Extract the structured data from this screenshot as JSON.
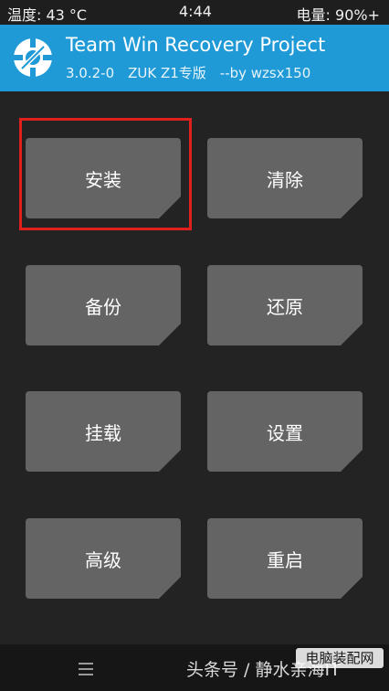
{
  "status_bar": {
    "temperature": "温度: 43 °C",
    "time": "4:44",
    "battery": "电量: 90%+"
  },
  "header": {
    "title": "Team Win Recovery Project",
    "subtitle": "3.0.2-0　ZUK Z1专版　--by wzsx150",
    "logo_icon": "twrp-logo-icon"
  },
  "menu": {
    "install": "安装",
    "wipe": "清除",
    "backup": "备份",
    "restore": "还原",
    "mount": "挂载",
    "settings": "设置",
    "advanced": "高级",
    "reboot": "重启"
  },
  "highlight": {
    "target": "install",
    "color": "#e0201c"
  },
  "nav_bar": {
    "menu_icon": "hamburger-menu-icon"
  },
  "watermark": {
    "text": "头条号 / 静水亲海IT",
    "logo_text": "电脑装配网"
  },
  "colors": {
    "header_bg": "#1f9ad6",
    "tile_bg": "#646464",
    "page_bg": "#232323"
  }
}
